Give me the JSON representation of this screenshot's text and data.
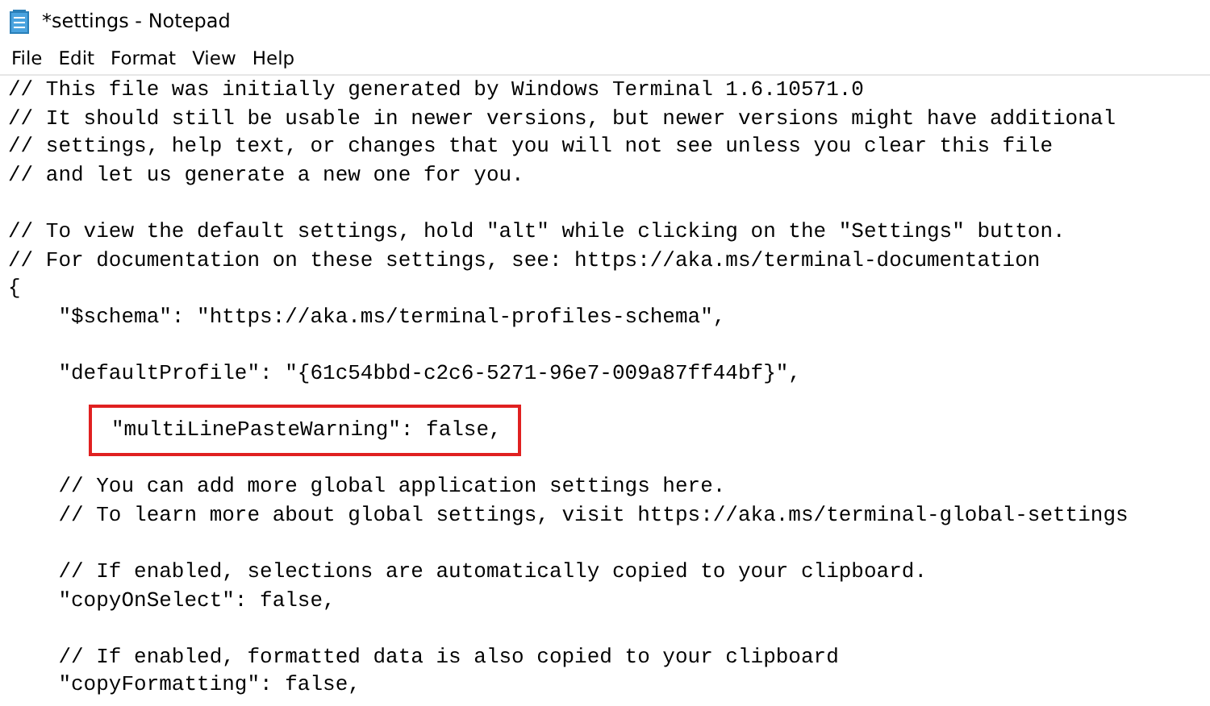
{
  "window": {
    "title": "*settings - Notepad"
  },
  "menu": [
    "File",
    "Edit",
    "Format",
    "View",
    "Help"
  ],
  "lines": [
    {
      "kind": "text",
      "text": "// This file was initially generated by Windows Terminal 1.6.10571.0"
    },
    {
      "kind": "text",
      "text": "// It should still be usable in newer versions, but newer versions might have additional"
    },
    {
      "kind": "text",
      "text": "// settings, help text, or changes that you will not see unless you clear this file"
    },
    {
      "kind": "text",
      "text": "// and let us generate a new one for you."
    },
    {
      "kind": "blank"
    },
    {
      "kind": "text",
      "text": "// To view the default settings, hold \"alt\" while clicking on the \"Settings\" button."
    },
    {
      "kind": "text",
      "text": "// For documentation on these settings, see: https://aka.ms/terminal-documentation"
    },
    {
      "kind": "text",
      "text": "{"
    },
    {
      "kind": "text",
      "text": "    \"$schema\": \"https://aka.ms/terminal-profiles-schema\","
    },
    {
      "kind": "blank"
    },
    {
      "kind": "text",
      "text": "    \"defaultProfile\": \"{61c54bbd-c2c6-5271-96e7-009a87ff44bf}\","
    },
    {
      "kind": "blank"
    },
    {
      "kind": "highlighted",
      "text": "\"multiLinePasteWarning\": false,"
    },
    {
      "kind": "blank"
    },
    {
      "kind": "text",
      "text": "    // You can add more global application settings here."
    },
    {
      "kind": "text",
      "text": "    // To learn more about global settings, visit https://aka.ms/terminal-global-settings"
    },
    {
      "kind": "blank"
    },
    {
      "kind": "text",
      "text": "    // If enabled, selections are automatically copied to your clipboard."
    },
    {
      "kind": "text",
      "text": "    \"copyOnSelect\": false,"
    },
    {
      "kind": "blank"
    },
    {
      "kind": "text",
      "text": "    // If enabled, formatted data is also copied to your clipboard"
    },
    {
      "kind": "text",
      "text": "    \"copyFormatting\": false,"
    }
  ]
}
